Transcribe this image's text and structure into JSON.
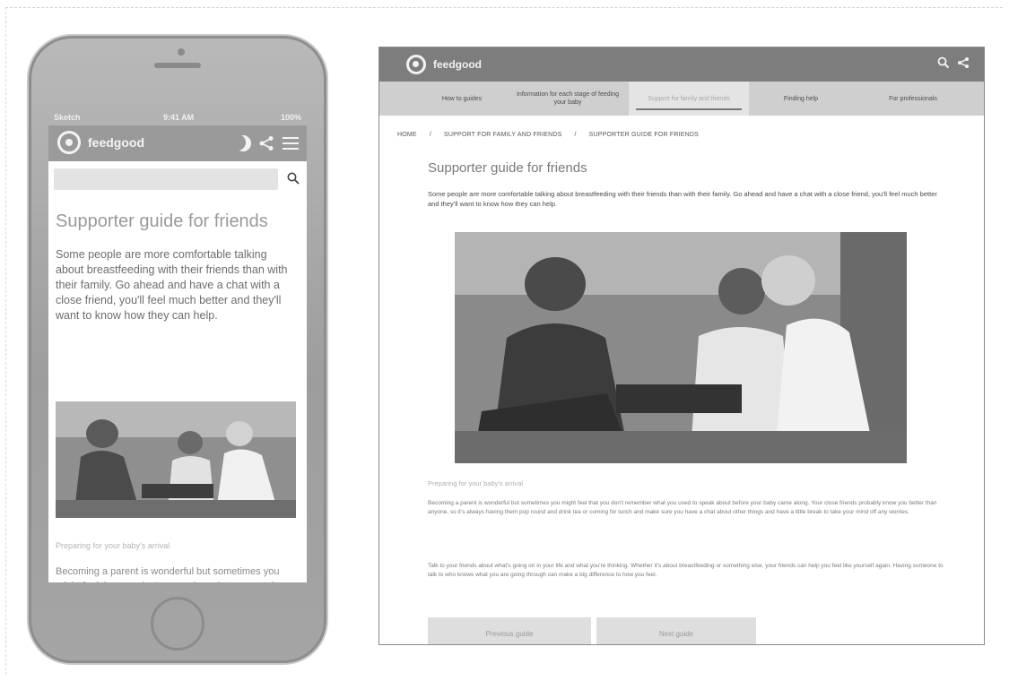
{
  "brand": {
    "name": "feedgood"
  },
  "phone": {
    "status": {
      "carrier": "Sketch",
      "time": "9:41 AM",
      "battery": "100%"
    },
    "title": "Supporter guide for friends",
    "body": "Some people are more comfortable talking about breastfeeding with their friends than with their family. Go ahead and have a chat with a close friend, you'll feel much better and they'll want to know how they can help.",
    "subhead": "Preparing for your baby's arrival",
    "body2": "Becoming a parent is wonderful but sometimes you might feel that you don't remember what you used to speak about before your baby came"
  },
  "desktop": {
    "nav": [
      {
        "label": "How to guides",
        "active": false
      },
      {
        "label": "Information for each stage of feeding your baby",
        "active": false
      },
      {
        "label": "Support for family and friends",
        "active": true
      },
      {
        "label": "Finding help",
        "active": false
      },
      {
        "label": "For professionals",
        "active": false
      }
    ],
    "breadcrumb": [
      "HOME",
      "/",
      "SUPPORT FOR FAMILY AND FRIENDS",
      "/",
      "SUPPORTER GUIDE FOR FRIENDS"
    ],
    "title": "Supporter guide for friends",
    "intro": "Some people are more comfortable talking about breastfeeding with their friends than with their family. Go ahead and have a chat with a close friend, you'll feel much better and they'll want to know how they can help.",
    "subhead": "Preparing for your baby's arrival",
    "para1": "Becoming a parent is wonderful but sometimes you might feel that you don't remember what you used to speak about before your baby came along. Your close friends probably know you better than anyone, so it's always having them pop round and drink tea or coming for lunch and make sure you have a chat about other things and have a little break to take your mind off any worries.",
    "para2": "Talk to your friends about what's going on in your life and what you're thinking. Whether it's about breastfeeding or something else, your friends can help you feel like yourself again. Having someone to talk to who knows what you are going through can make a big difference to how you feel.",
    "buttons": [
      "Previous guide",
      "Next guide"
    ]
  },
  "colors": {
    "header": "#7d7d7d",
    "nav": "#cfcfcf",
    "phone_shell": "#a5a5a5"
  }
}
